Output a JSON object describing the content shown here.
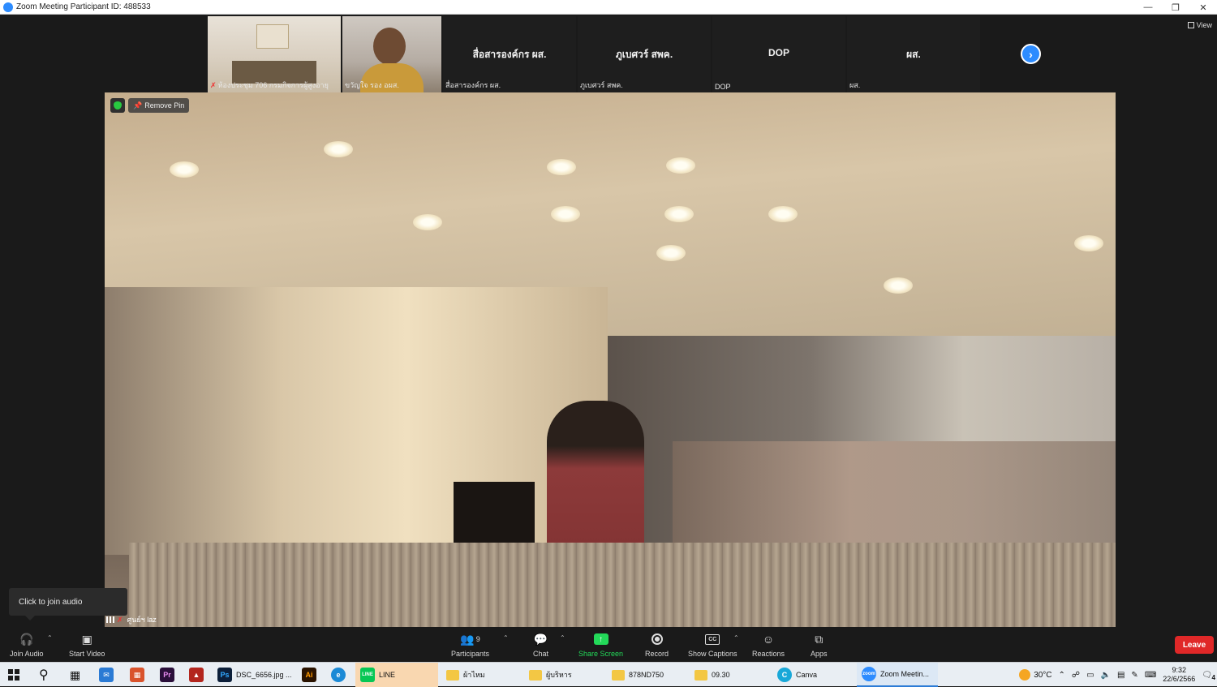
{
  "window": {
    "title": "Zoom Meeting Participant ID: 488533"
  },
  "thumbnails": [
    {
      "name": "ห้องประชุม 706 กรมกิจการผู้สูงอายุ",
      "muted": true,
      "type": "video-room"
    },
    {
      "name": "ขวัญใจ  รอง อผส.",
      "muted": false,
      "type": "video-person"
    },
    {
      "name": "สื่อสารองค์กร ผส.",
      "center_label": "สื่อสารองค์กร ผส.",
      "type": "name-only"
    },
    {
      "name": "ภูเบศวร์ สพค.",
      "center_label": "ภูเบศวร์ สพค.",
      "type": "name-only"
    },
    {
      "name": "DOP",
      "center_label": "DOP",
      "type": "name-only"
    },
    {
      "name": "ผส.",
      "center_label": "ผส.",
      "type": "name-only"
    }
  ],
  "view_button": {
    "label": "View"
  },
  "main_video": {
    "remove_pin_label": "Remove Pin",
    "speaker_name": "ศูนย์ฯ laz",
    "speaker_muted": true
  },
  "tooltip": {
    "text": "Click to join audio"
  },
  "toolbar": {
    "join_audio": "Join Audio",
    "start_video": "Start Video",
    "participants": "Participants",
    "participants_count": "9",
    "chat": "Chat",
    "share_screen": "Share Screen",
    "record": "Record",
    "show_captions": "Show Captions",
    "reactions": "Reactions",
    "apps": "Apps",
    "leave": "Leave"
  },
  "taskbar": {
    "apps": [
      {
        "label": "DSC_6656.jpg ...",
        "icon": "Ps"
      },
      {
        "label": "LINE",
        "icon": "LINE"
      },
      {
        "label": "ผ้าไหม",
        "icon": "folder"
      },
      {
        "label": "ผู้บริหาร",
        "icon": "folder"
      },
      {
        "label": "878ND750",
        "icon": "folder"
      },
      {
        "label": "09.30",
        "icon": "folder"
      },
      {
        "label": "Canva",
        "icon": "canva"
      },
      {
        "label": "Zoom Meetin...",
        "icon": "zoom"
      }
    ],
    "weather": "30°C",
    "time": "9:32",
    "date": "22/6/2566",
    "notification_count": "4"
  },
  "colors": {
    "zoom_blue": "#2d8cff",
    "share_green": "#23d959",
    "leave_red": "#e02828"
  }
}
